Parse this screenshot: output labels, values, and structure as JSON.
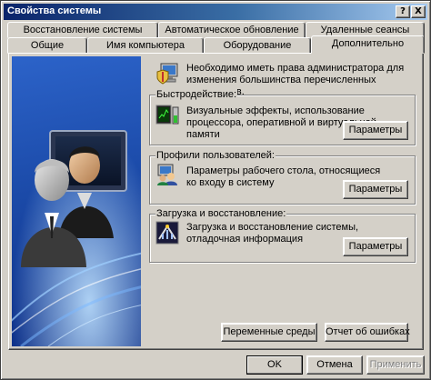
{
  "window": {
    "title": "Свойства системы",
    "help_button": "?",
    "close_button": "X"
  },
  "tabs": {
    "row1": [
      {
        "label": "Восстановление системы"
      },
      {
        "label": "Автоматическое обновление"
      },
      {
        "label": "Удаленные сеансы"
      }
    ],
    "row2": [
      {
        "label": "Общие"
      },
      {
        "label": "Имя компьютера"
      },
      {
        "label": "Оборудование"
      },
      {
        "label": "Дополнительно",
        "active": true
      }
    ]
  },
  "notice": {
    "text": "Необходимо иметь права администратора для изменения большинства перечисленных параметров."
  },
  "performance": {
    "title": "Быстродействие:",
    "description": "Визуальные эффекты, использование процессора, оперативной и виртуальной памяти",
    "button": "Параметры"
  },
  "profiles": {
    "title": "Профили пользователей:",
    "description": "Параметры рабочего стола, относящиеся ко входу в систему",
    "button": "Параметры"
  },
  "startup": {
    "title": "Загрузка и восстановление:",
    "description": "Загрузка и восстановление системы, отладочная информация",
    "button": "Параметры"
  },
  "bottom_buttons": {
    "env_vars": "Переменные среды",
    "error_report": "Отчет об ошибках"
  },
  "dialog_buttons": {
    "ok": "OK",
    "cancel": "Отмена",
    "apply": "Применить"
  },
  "icons": {
    "admin": "admin-shield-computer-icon",
    "performance": "performance-monitor-icon",
    "profiles": "user-profiles-icon",
    "startup": "startup-recovery-icon"
  },
  "colors": {
    "title_bar_start": "#0a246a",
    "title_bar_end": "#a6caf0",
    "face": "#d4d0c8",
    "art_blue": "#1b4aa8"
  }
}
